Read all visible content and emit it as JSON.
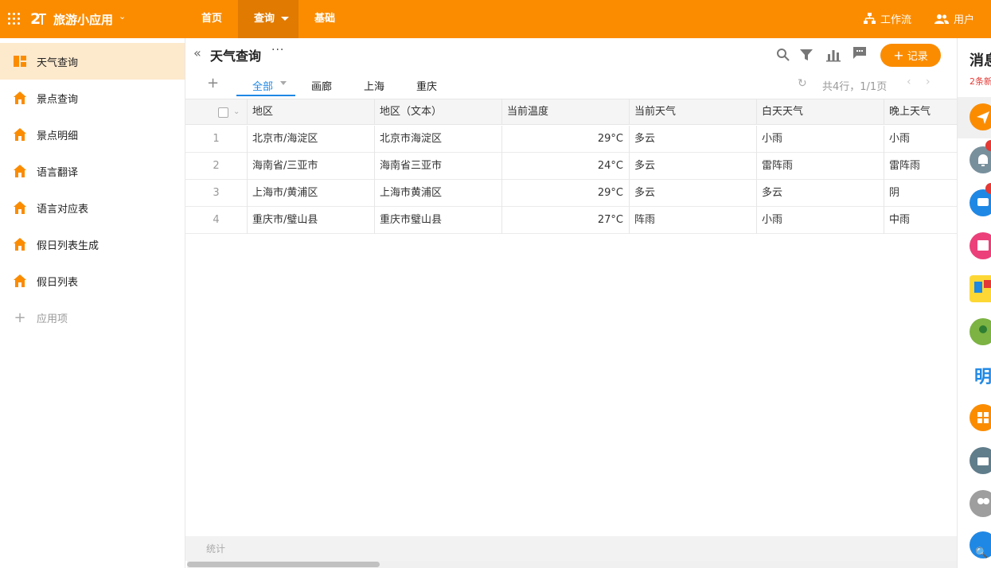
{
  "topbar": {
    "app_name": "旅游小应用",
    "nav": [
      "首页",
      "查询",
      "基础"
    ],
    "workflow_label": "工作流",
    "users_label": "用户",
    "accent_color": "#fb8c00"
  },
  "sidebar": {
    "items": [
      {
        "label": "天气查询",
        "icon": "dashboard-icon",
        "active": true
      },
      {
        "label": "景点查询",
        "icon": "home-icon"
      },
      {
        "label": "景点明细",
        "icon": "home-icon"
      },
      {
        "label": "语言翻译",
        "icon": "home-icon"
      },
      {
        "label": "语言对应表",
        "icon": "home-icon"
      },
      {
        "label": "假日列表生成",
        "icon": "home-icon"
      },
      {
        "label": "假日列表",
        "icon": "home-icon"
      }
    ],
    "add_label": "应用项"
  },
  "main": {
    "title": "天气查询",
    "add_record_label": "记录",
    "tabs": [
      "全部",
      "画廊",
      "上海",
      "重庆"
    ],
    "pager_text": "共4行，1/1页",
    "columns": [
      "地区",
      "地区（文本）",
      "当前温度",
      "当前天气",
      "白天天气",
      "晚上天气"
    ],
    "rows": [
      {
        "n": "1",
        "region": "北京市/海淀区",
        "region_text": "北京市海淀区",
        "temp": "29°C",
        "now": "多云",
        "day": "小雨",
        "night": "小雨"
      },
      {
        "n": "2",
        "region": "海南省/三亚市",
        "region_text": "海南省三亚市",
        "temp": "24°C",
        "now": "多云",
        "day": "雷阵雨",
        "night": "雷阵雨"
      },
      {
        "n": "3",
        "region": "上海市/黄浦区",
        "region_text": "上海市黄浦区",
        "temp": "29°C",
        "now": "多云",
        "day": "多云",
        "night": "阴"
      },
      {
        "n": "4",
        "region": "重庆市/璧山县",
        "region_text": "重庆市璧山县",
        "temp": "27°C",
        "now": "阵雨",
        "day": "小雨",
        "night": "中雨"
      }
    ],
    "footer_label": "统计"
  },
  "right_panel": {
    "title": "消息",
    "subtitle": "2条新",
    "text_icon": "明"
  }
}
